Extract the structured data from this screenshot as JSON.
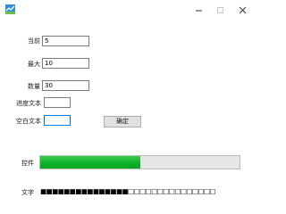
{
  "window": {
    "minimize": "–",
    "close": "✕"
  },
  "form": {
    "current": {
      "label": "当前",
      "value": "5"
    },
    "max": {
      "label": "最大",
      "value": "10"
    },
    "count": {
      "label": "数量",
      "value": "30"
    },
    "progress_text": {
      "label": "进度文本",
      "value": ""
    },
    "empty_text": {
      "label": "空白文本",
      "value": ""
    },
    "confirm_label": "确定"
  },
  "control": {
    "label": "控件",
    "progress_fraction": 0.5
  },
  "text_row": {
    "label": "文字",
    "blocks": "■■■■■■■■■■■■■■■□□□□□□□□□□□□□□□"
  },
  "colors": {
    "progress_fill": "#06b025",
    "progress_track": "#e6e6e6",
    "focus_border": "#0078d7"
  }
}
